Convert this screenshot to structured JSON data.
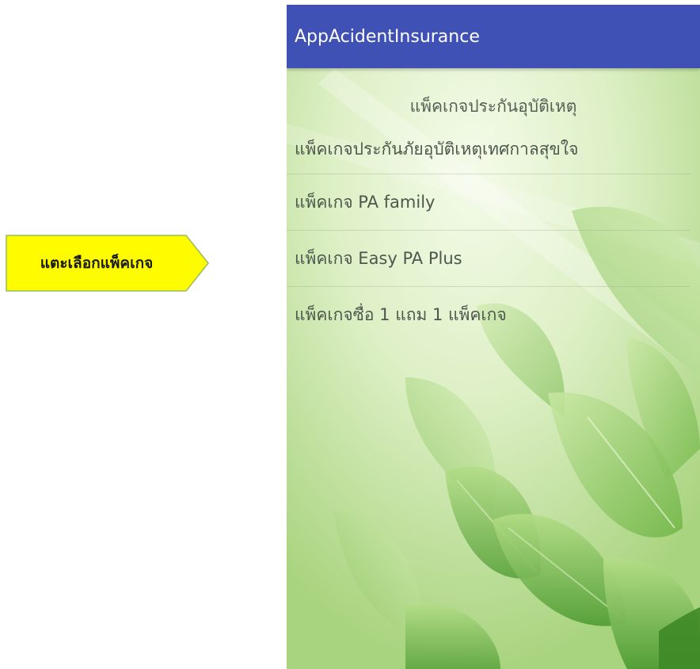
{
  "callout": {
    "text": "แตะเลือกแพ็คเกจ",
    "fill_color": "#fffc00",
    "border_color": "#9bbb59"
  },
  "app": {
    "title": "AppAcidentInsurance",
    "bar_color": "#3f51b5",
    "heading": "แพ็คเกจประกันอุบัติเหตุ",
    "packages": [
      {
        "label": "แพ็คเกจประกันภัยอุบัติเหตุเทศกาลสุขใจ"
      },
      {
        "label": "แพ็คเกจ PA family"
      },
      {
        "label": "แพ็คเกจ Easy PA Plus"
      },
      {
        "label": "แพ็คเกจซื่อ 1 แถม 1 แพ็คเกจ"
      }
    ],
    "background": "green-leaves-image"
  }
}
